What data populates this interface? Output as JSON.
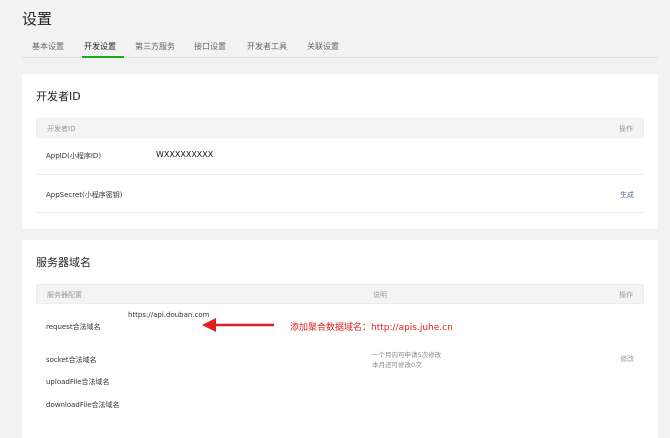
{
  "page": {
    "title": "设置"
  },
  "tabs": [
    {
      "label": "基本设置",
      "active": false
    },
    {
      "label": "开发设置",
      "active": true
    },
    {
      "label": "第三方服务",
      "active": false
    },
    {
      "label": "接口设置",
      "active": false
    },
    {
      "label": "开发者工具",
      "active": false
    },
    {
      "label": "关联设置",
      "active": false
    }
  ],
  "developer_card": {
    "title": "开发者ID",
    "header": {
      "col1": "开发者ID",
      "action": "操作"
    },
    "rows": [
      {
        "label": "AppID(小程序ID)",
        "value": "WXXXXXXXXX",
        "action": ""
      },
      {
        "label": "AppSecret(小程序密钥)",
        "value": "",
        "action": "生成"
      }
    ]
  },
  "domain_card": {
    "title": "服务器域名",
    "header": {
      "col1": "服务器配置",
      "col2": "说明",
      "action": "操作"
    },
    "rows": [
      {
        "label": "request合法域名",
        "value": "https://api.douban.com"
      },
      {
        "label": "socket合法域名",
        "value": ""
      },
      {
        "label": "uploadFile合法域名",
        "value": ""
      },
      {
        "label": "downloadFile合法域名",
        "value": ""
      }
    ],
    "description_lines": [
      "一个月内可申请5次修改",
      "本月还可修改0次"
    ],
    "modify_label": "修改"
  },
  "annotation": {
    "text": "添加聚合数据域名：http://apis.juhe.cn",
    "color": "#e02020"
  },
  "colors": {
    "accent": "#1aad19",
    "link": "#576b95",
    "annotation": "#e02020"
  }
}
